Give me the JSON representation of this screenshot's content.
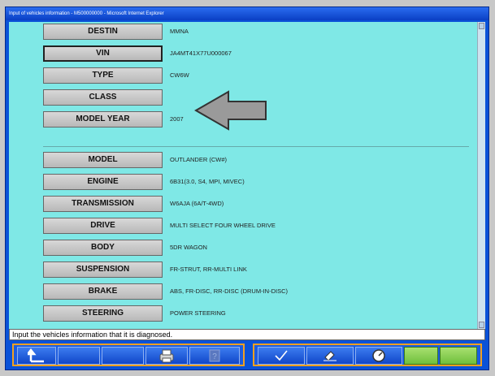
{
  "window": {
    "title": "Input of vehicles information - M500000000 - Microsoft Internet Explorer"
  },
  "fields": [
    {
      "label": "DESTIN",
      "value": "MMNA"
    },
    {
      "label": "VIN",
      "value": "JA4MT41X77U000067"
    },
    {
      "label": "TYPE",
      "value": "CW6W"
    },
    {
      "label": "CLASS",
      "value": ""
    },
    {
      "label": "MODEL YEAR",
      "value": "2007"
    },
    {
      "label": "MODEL",
      "value": "OUTLANDER (CW#)"
    },
    {
      "label": "ENGINE",
      "value": "6B31(3.0, S4, MPI, MIVEC)"
    },
    {
      "label": "TRANSMISSION",
      "value": "W6AJA (6A/T-4WD)"
    },
    {
      "label": "DRIVE",
      "value": "MULTI SELECT FOUR WHEEL DRIVE"
    },
    {
      "label": "BODY",
      "value": "5DR WAGON"
    },
    {
      "label": "SUSPENSION",
      "value": "FR-STRUT, RR-MULTI LINK"
    },
    {
      "label": "BRAKE",
      "value": "ABS, FR-DISC, RR-DISC (DRUM-IN-DISC)"
    },
    {
      "label": "STEERING",
      "value": "POWER STEERING"
    }
  ],
  "status": {
    "message": "Input the vehicles information that it is diagnosed."
  },
  "toolbar": {
    "icons": [
      "up-arrow-icon",
      "print-icon",
      "help-icon",
      "check-icon",
      "eraser-icon",
      "gauge-icon"
    ],
    "accent": "#f0a020"
  }
}
